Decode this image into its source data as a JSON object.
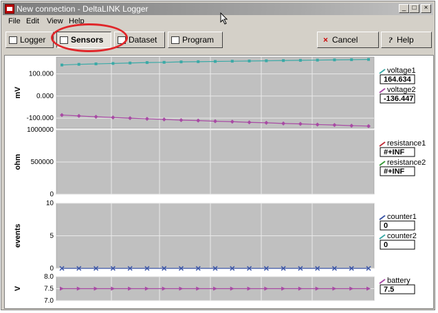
{
  "window": {
    "title": "New connection - DeltaLINK Logger",
    "min": "_",
    "max": "□",
    "close": "×"
  },
  "menu": [
    "File",
    "Edit",
    "View",
    "Help"
  ],
  "toolbar": {
    "logger": "Logger",
    "sensors": "Sensors",
    "dataset": "Dataset",
    "program": "Program",
    "cancel": "Cancel",
    "help": "Help"
  },
  "annotation": {
    "highlighted_tab": "Sensors",
    "color": "#e0262a"
  },
  "colors": {
    "plot_bg": "#c0c0c0",
    "teal": "#3aa9a6",
    "purple": "#a84aa4",
    "blue": "#3b55a6",
    "red": "#c0303a",
    "green": "#3a9a3a"
  },
  "panels": [
    {
      "ylabel": "mV",
      "ticks": [
        "100.000",
        "0.000",
        "-100.000"
      ],
      "tick_values": [
        100,
        0,
        -100
      ],
      "ylim": [
        -140,
        170
      ],
      "series": [
        {
          "name": "voltage1",
          "value": "164.634",
          "color": "#3aa9a6",
          "marker": "square",
          "values": [
            140,
            143,
            145,
            147,
            149,
            151,
            152,
            154,
            155,
            156,
            157,
            158,
            159,
            160,
            161,
            162,
            163,
            164,
            165
          ]
        },
        {
          "name": "voltage2",
          "value": "-136.447",
          "color": "#a84aa4",
          "marker": "diamond",
          "values": [
            -86,
            -90,
            -94,
            -97,
            -100,
            -103,
            -106,
            -109,
            -111,
            -114,
            -116,
            -119,
            -121,
            -124,
            -126,
            -129,
            -131,
            -134,
            -136
          ]
        }
      ]
    },
    {
      "ylabel": "ohm",
      "ticks": [
        "1000000",
        "500000",
        "0"
      ],
      "tick_values": [
        1000000,
        500000,
        0
      ],
      "ylim": [
        0,
        1000000
      ],
      "series": [
        {
          "name": "resistance1",
          "value": "#+INF",
          "color": "#c0303a",
          "marker": "none",
          "values": []
        },
        {
          "name": "resistance2",
          "value": "#+INF",
          "color": "#3a9a3a",
          "marker": "none",
          "values": []
        }
      ]
    },
    {
      "ylabel": "events",
      "ticks": [
        "10",
        "5",
        "0"
      ],
      "tick_values": [
        10,
        5,
        0
      ],
      "ylim": [
        0,
        10
      ],
      "series": [
        {
          "name": "counter1",
          "value": "0",
          "color": "#3b55a6",
          "marker": "x",
          "values": [
            0,
            0,
            0,
            0,
            0,
            0,
            0,
            0,
            0,
            0,
            0,
            0,
            0,
            0,
            0,
            0,
            0,
            0,
            0
          ]
        },
        {
          "name": "counter2",
          "value": "0",
          "color": "#3aa9a6",
          "marker": "none",
          "values": []
        }
      ]
    },
    {
      "ylabel": "V",
      "ticks": [
        "8.0",
        "7.5",
        "7.0"
      ],
      "tick_values": [
        8.0,
        7.5,
        7.0
      ],
      "ylim": [
        7.0,
        8.0
      ],
      "series": [
        {
          "name": "battery",
          "value": "7.5",
          "color": "#a84aa4",
          "marker": "tri",
          "values": [
            7.5,
            7.5,
            7.5,
            7.5,
            7.5,
            7.5,
            7.5,
            7.5,
            7.5,
            7.5,
            7.5,
            7.5,
            7.5,
            7.5,
            7.5,
            7.5,
            7.5,
            7.5,
            7.5
          ]
        }
      ]
    }
  ]
}
